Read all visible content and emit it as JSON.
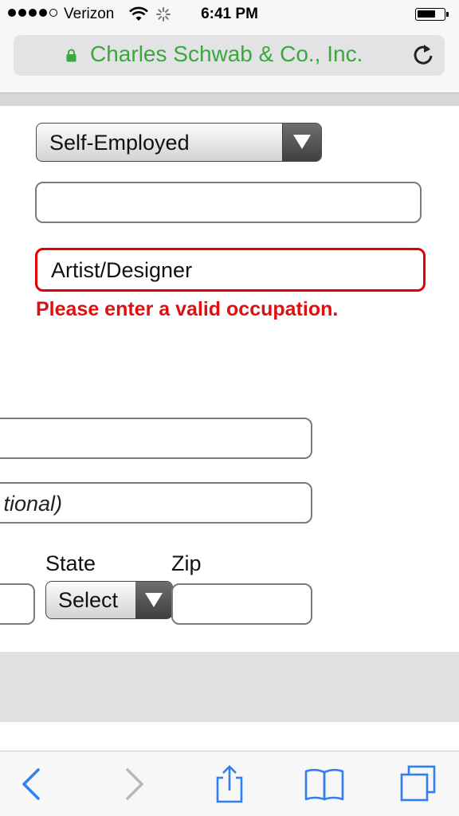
{
  "status_bar": {
    "carrier": "Verizon",
    "time": "6:41 PM",
    "signal_dots_filled": 4,
    "signal_dots_total": 5
  },
  "browser": {
    "url_title": "Charles Schwab & Co., Inc.",
    "url_color": "#3aa83a"
  },
  "form": {
    "employment_status": "Self-Employed",
    "employer_field_value": "",
    "occupation_value": "Artist/Designer",
    "occupation_error": "Please enter a valid occupation.",
    "error_color": "#dd1111",
    "address_line1_value": "",
    "address_line2_placeholder_visible": "tional)",
    "state_label": "State",
    "state_select_value": "Select",
    "zip_label": "Zip",
    "zip_value": ""
  },
  "toolbar": {
    "icons": [
      "back-icon",
      "forward-icon",
      "share-icon",
      "bookmarks-icon",
      "tabs-icon"
    ],
    "accent": "#2f7ff0"
  }
}
